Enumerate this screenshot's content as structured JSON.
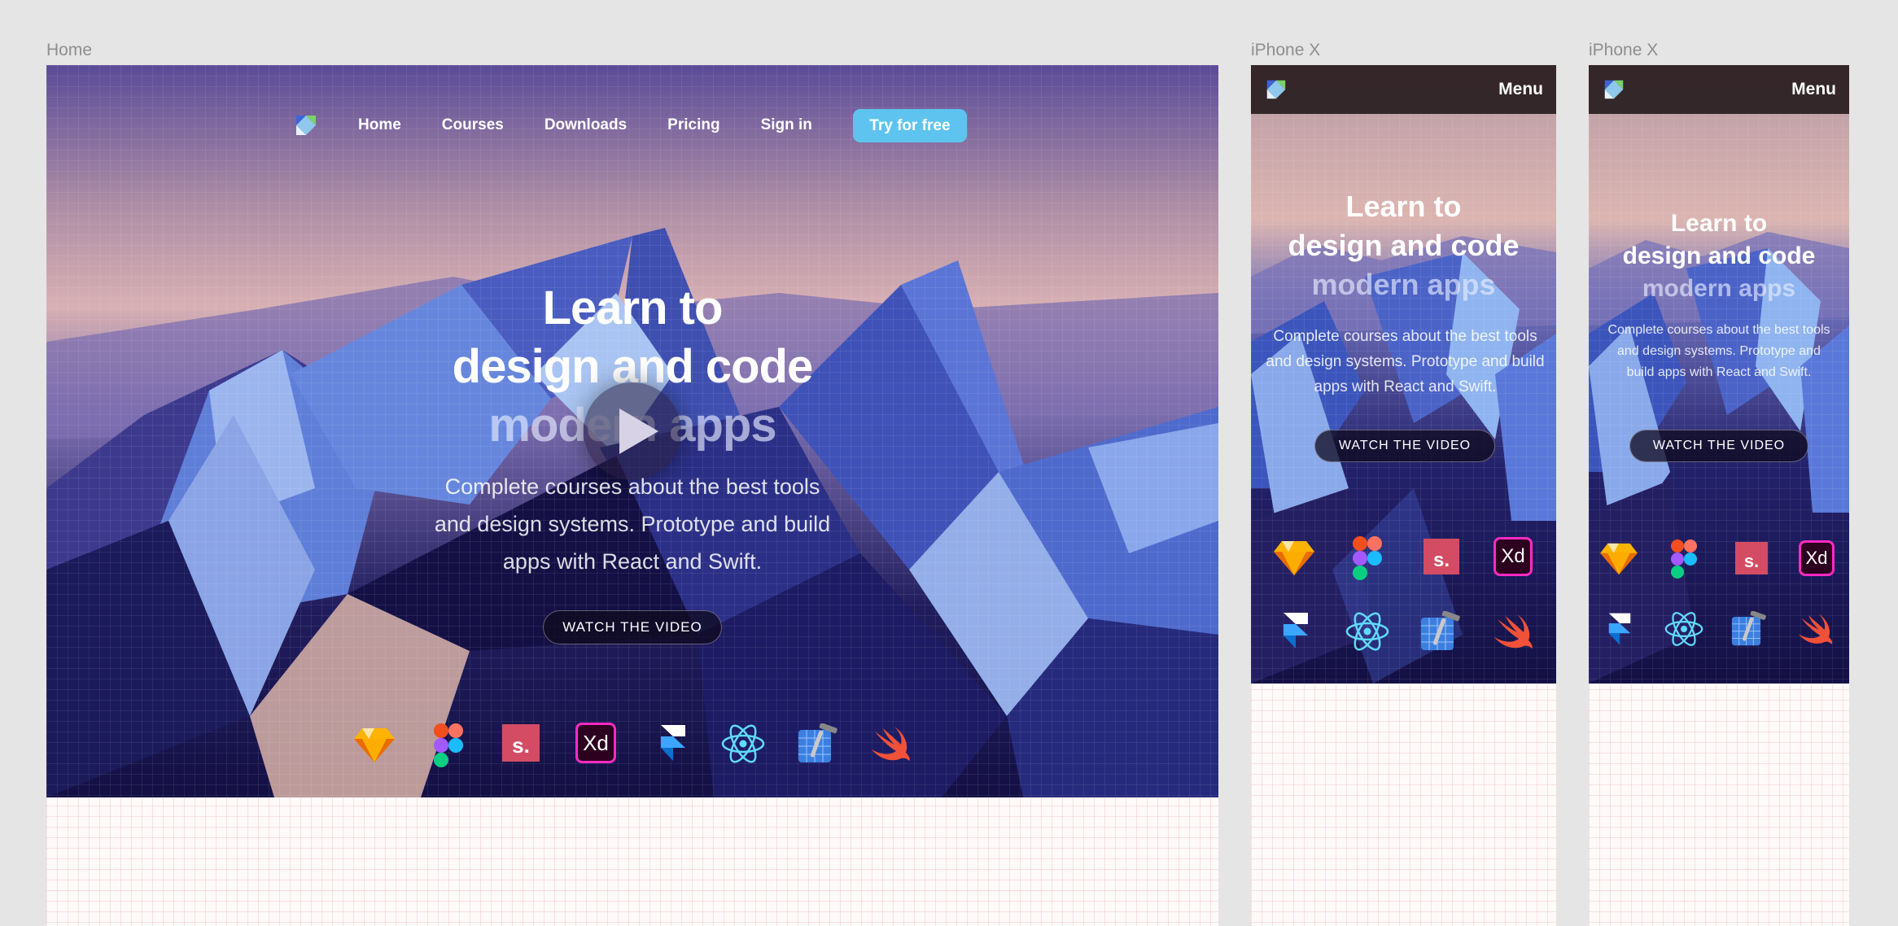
{
  "frames": {
    "desktop_label": "Home",
    "mobile1_label": "iPhone X",
    "mobile2_label": "iPhone X"
  },
  "nav": {
    "items": [
      "Home",
      "Courses",
      "Downloads",
      "Pricing",
      "Sign in"
    ],
    "cta": "Try for free",
    "logo_icon": "logo-icon"
  },
  "hero": {
    "title_line1": "Learn to",
    "title_line2": "design and code",
    "title_line3": "modern apps",
    "subtitle_desktop": "Complete courses about the best tools and design systems. Prototype and build apps with React and Swift.",
    "subtitle_mobile": "Complete courses about the best tools and design systems. Prototype and build apps with React and Swift.",
    "watch_button": "WATCH THE VIDEO"
  },
  "mobile": {
    "menu_label": "Menu"
  },
  "tools": [
    "sketch-icon",
    "figma-icon",
    "sketch-runner-icon",
    "adobe-xd-icon",
    "framer-icon",
    "react-icon",
    "xcode-icon",
    "swift-icon"
  ],
  "colors": {
    "cta": "#5ec4ef",
    "hero_dark": "#141045",
    "hero_pink": "#d8b0b3",
    "canvas": "#e5e5e5"
  }
}
